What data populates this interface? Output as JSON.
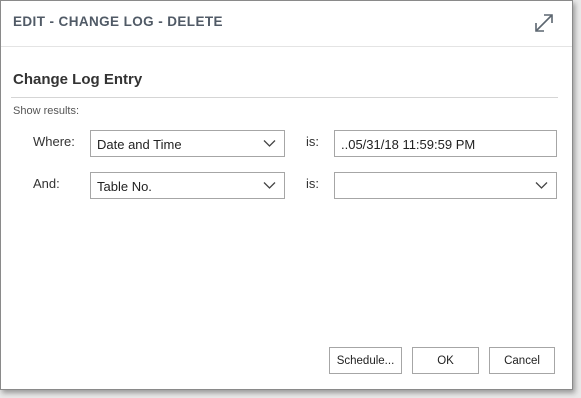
{
  "dialog": {
    "title": "EDIT - CHANGE LOG - DELETE",
    "expand_icon": "expand-diagonal-arrows-icon"
  },
  "section": {
    "title": "Change Log Entry",
    "subtitle": "Show results:"
  },
  "filters": [
    {
      "label": "Where:",
      "field": "Date and Time",
      "operator": "is:",
      "value": "..05/31/18 11:59:59 PM"
    },
    {
      "label": "And:",
      "field": "Table No.",
      "operator": "is:",
      "value": ""
    }
  ],
  "buttons": {
    "schedule": "Schedule...",
    "ok": "OK",
    "cancel": "Cancel"
  },
  "icons": {
    "dropdown": "chevron-down-icon"
  },
  "colors": {
    "title_text": "#505a66",
    "border": "#a6a6a6",
    "background": "#ffffff"
  }
}
